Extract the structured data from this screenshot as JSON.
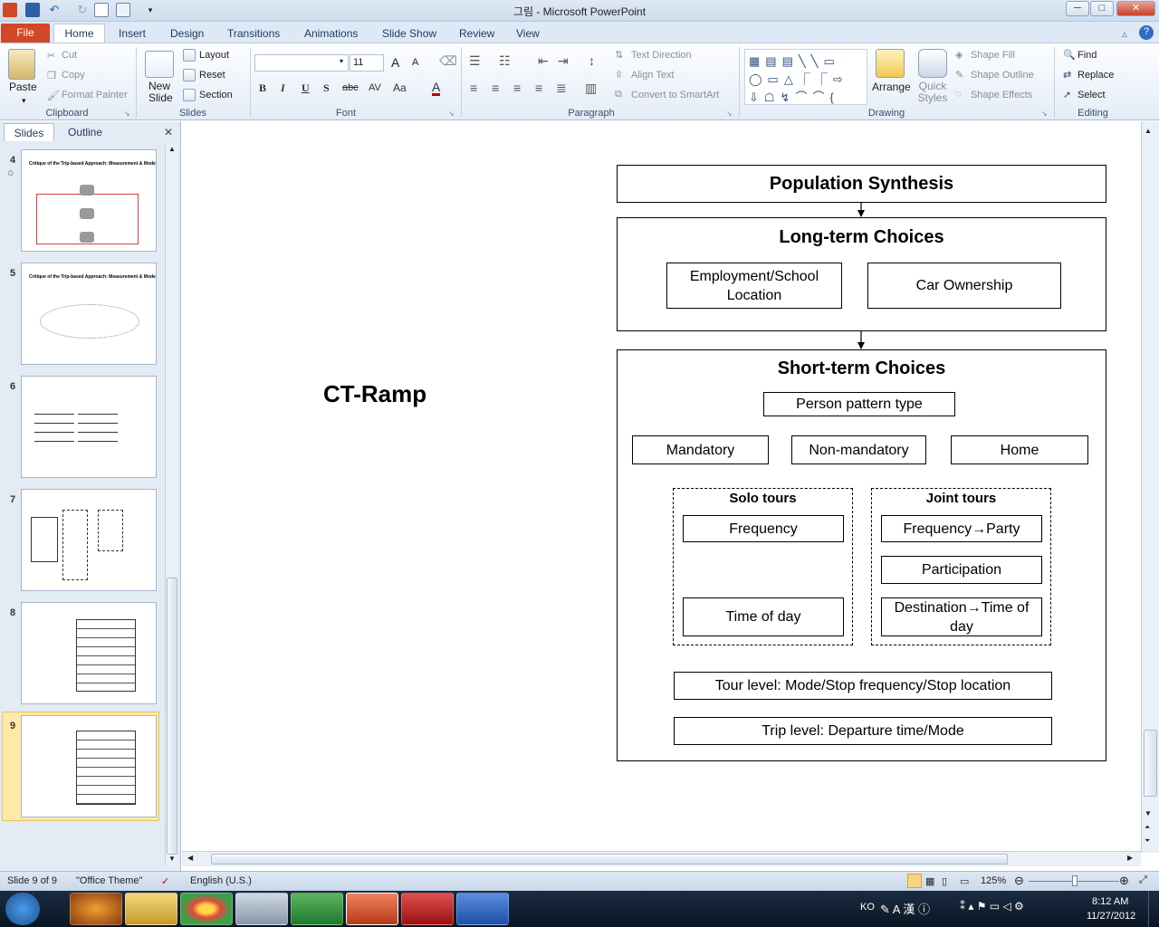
{
  "window": {
    "title": "그림 - Microsoft PowerPoint",
    "minimize": "─",
    "maximize": "□",
    "close": "✕"
  },
  "ribbon_tabs": [
    "File",
    "Home",
    "Insert",
    "Design",
    "Transitions",
    "Animations",
    "Slide Show",
    "Review",
    "View"
  ],
  "ribbon": {
    "clipboard": {
      "label": "Clipboard",
      "paste": "Paste",
      "cut": "Cut",
      "copy": "Copy",
      "format_painter": "Format Painter"
    },
    "slides": {
      "label": "Slides",
      "new_slide": "New Slide",
      "layout": "Layout",
      "reset": "Reset",
      "section": "Section"
    },
    "font": {
      "label": "Font",
      "font_name": "",
      "font_size": "11",
      "bold": "B",
      "italic": "I",
      "underline": "U",
      "shadow": "S",
      "strike": "abc",
      "spacing": "AV",
      "case": "Aa",
      "color": "A",
      "grow": "A",
      "shrink": "A"
    },
    "paragraph": {
      "label": "Paragraph",
      "text_direction": "Text Direction",
      "align_text": "Align Text",
      "convert_smartart": "Convert to SmartArt"
    },
    "drawing": {
      "label": "Drawing",
      "arrange": "Arrange",
      "quick_styles": "Quick Styles",
      "shape_fill": "Shape Fill",
      "shape_outline": "Shape Outline",
      "shape_effects": "Shape Effects"
    },
    "editing": {
      "label": "Editing",
      "find": "Find",
      "replace": "Replace",
      "select": "Select"
    }
  },
  "panel": {
    "tab_slides": "Slides",
    "tab_outline": "Outline",
    "close": "✕",
    "thumbnails": [
      {
        "number": "4",
        "title": "Critique of the Trip-based Approach: Measurement & Modeling"
      },
      {
        "number": "5",
        "title": "Critique of the Trip-based Approach: Measurement & Modeling"
      },
      {
        "number": "6",
        "title": ""
      },
      {
        "number": "7",
        "title": ""
      },
      {
        "number": "8",
        "title": ""
      },
      {
        "number": "9",
        "title": ""
      }
    ]
  },
  "slide": {
    "title": "CT-Ramp",
    "diagram": {
      "population_synthesis": "Population Synthesis",
      "long_term": {
        "heading": "Long-term Choices",
        "employment": "Employment/School Location",
        "car_ownership": "Car Ownership"
      },
      "short_term": {
        "heading": "Short-term Choices",
        "person_pattern": "Person pattern type",
        "mandatory": "Mandatory",
        "non_mandatory": "Non-mandatory",
        "home": "Home",
        "solo": {
          "heading": "Solo tours",
          "frequency": "Frequency",
          "time_of_day": "Time of day"
        },
        "joint": {
          "heading": "Joint tours",
          "frequency_party": "Frequency→Party",
          "participation": "Participation",
          "destination_time": "Destination→Time of day"
        },
        "tour_level": "Tour level: Mode/Stop frequency/Stop  location",
        "trip_level": "Trip level: Departure  time/Mode"
      }
    }
  },
  "status": {
    "slide_info": "Slide 9 of 9",
    "theme": "\"Office Theme\"",
    "language": "English (U.S.)",
    "zoom": "125%"
  },
  "taskbar": {
    "lang": "KO",
    "time": "8:12 AM",
    "date": "11/27/2012"
  }
}
